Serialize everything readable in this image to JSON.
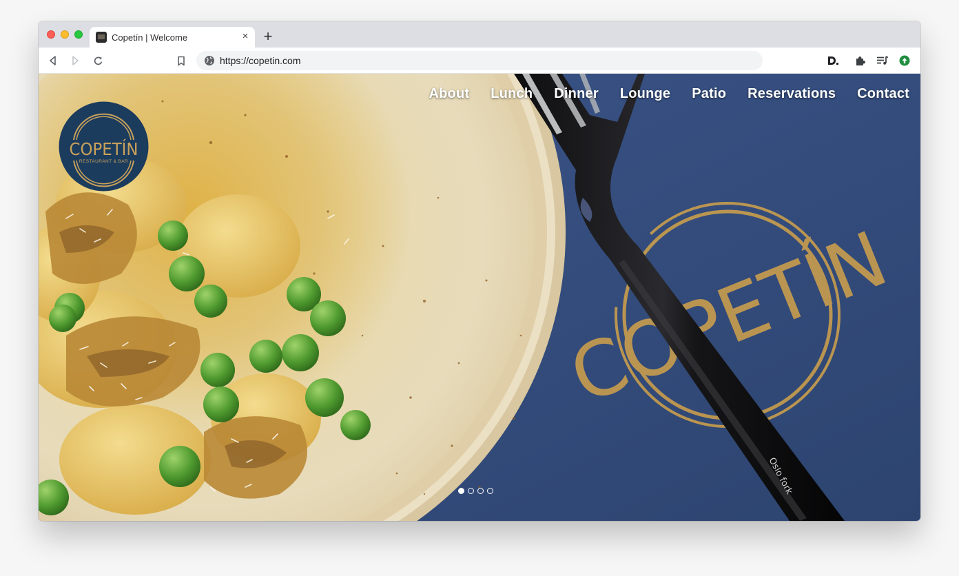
{
  "browser": {
    "tab_title": "Copetín | Welcome",
    "new_tab_label": "+",
    "close_label": "×",
    "url": "https://copetin.com"
  },
  "site": {
    "nav": [
      "About",
      "Lunch",
      "Dinner",
      "Lounge",
      "Patio",
      "Reservations",
      "Contact"
    ],
    "logo": {
      "name": "COPETÍN",
      "subtitle": "RESTAURANT & BAR"
    },
    "placemat_logo_text": "COPETÍN",
    "fork_engraving": "Oslo fork",
    "slider": {
      "slide_count": 4,
      "active_index": 0
    }
  },
  "colors": {
    "logo_navy": "#1c3c5e",
    "logo_gold": "#c9a15a",
    "placemat_blue": "#354d79",
    "plate_cream": "#e9dcb6"
  },
  "icons": [
    "back-icon",
    "forward-icon",
    "reload-icon",
    "bookmark-icon",
    "globe-icon",
    "d-extension-icon",
    "puzzle-extension-icon",
    "playlist-icon",
    "update-icon"
  ]
}
